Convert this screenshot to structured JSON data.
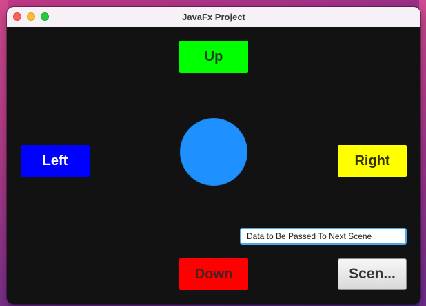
{
  "window": {
    "title": "JavaFx Project"
  },
  "controls": {
    "up_label": "Up",
    "left_label": "Left",
    "right_label": "Right",
    "down_label": "Down",
    "scene_label": "Scen..."
  },
  "text_field": {
    "value": "Data to Be Passed To Next Scene"
  },
  "colors": {
    "up": "#00ff00",
    "left": "#0000ff",
    "right": "#ffff00",
    "down": "#ff0000",
    "ball": "#1e90ff",
    "background": "#121212"
  },
  "icons": {
    "close": "close-icon",
    "minimize": "minimize-icon",
    "zoom": "zoom-icon"
  }
}
